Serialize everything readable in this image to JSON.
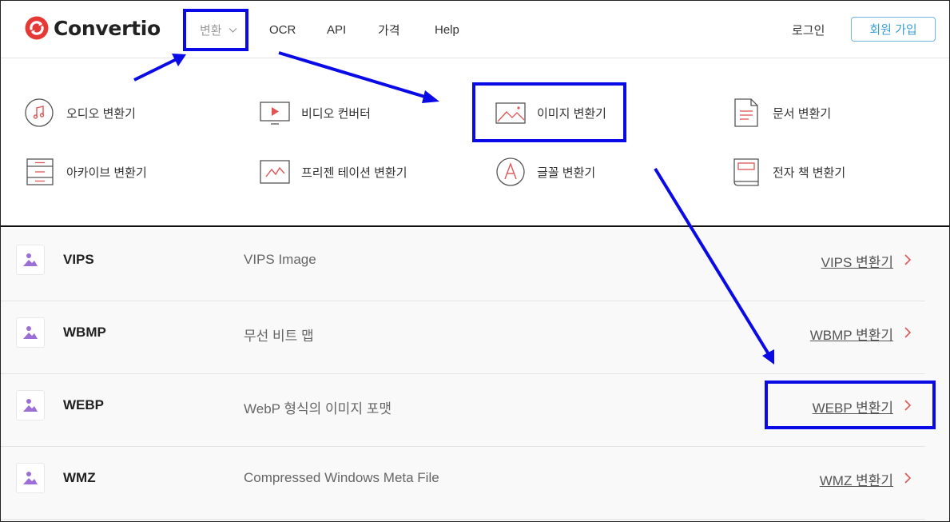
{
  "header": {
    "logo_text": "Convertio",
    "nav": {
      "convert": "변환",
      "ocr": "OCR",
      "api": "API",
      "price": "가격",
      "help": "Help"
    },
    "login": "로그인",
    "signup": "회원 가입"
  },
  "dropdown": {
    "items": [
      {
        "label": "오디오 변환기",
        "icon": "music-note-icon"
      },
      {
        "label": "비디오 컨버터",
        "icon": "video-play-icon"
      },
      {
        "label": "이미지 변환기",
        "icon": "image-landscape-icon"
      },
      {
        "label": "문서 변환기",
        "icon": "document-icon"
      },
      {
        "label": "아카이브 변환기",
        "icon": "archive-icon"
      },
      {
        "label": "프리젠 테이션 변환기",
        "icon": "presentation-chart-icon"
      },
      {
        "label": "글꼴 변환기",
        "icon": "font-letter-icon"
      },
      {
        "label": "전자 책 변환기",
        "icon": "ebook-icon"
      }
    ]
  },
  "formats": [
    {
      "name": "VIPS",
      "description": "VIPS Image",
      "link": "VIPS 변환기"
    },
    {
      "name": "WBMP",
      "description": "무선 비트 맵",
      "link": "WBMP 변환기"
    },
    {
      "name": "WEBP",
      "description": "WebP 형식의 이미지 포맷",
      "link": "WEBP 변환기"
    },
    {
      "name": "WMZ",
      "description": "Compressed Windows Meta File",
      "link": "WMZ 변환기"
    }
  ],
  "colors": {
    "brand_red": "#e53935",
    "icon_red": "#e05555",
    "format_icon_purple": "#9b6fd6",
    "annotation_blue": "#0a0ae6",
    "signup_blue": "#3a9fd6"
  }
}
